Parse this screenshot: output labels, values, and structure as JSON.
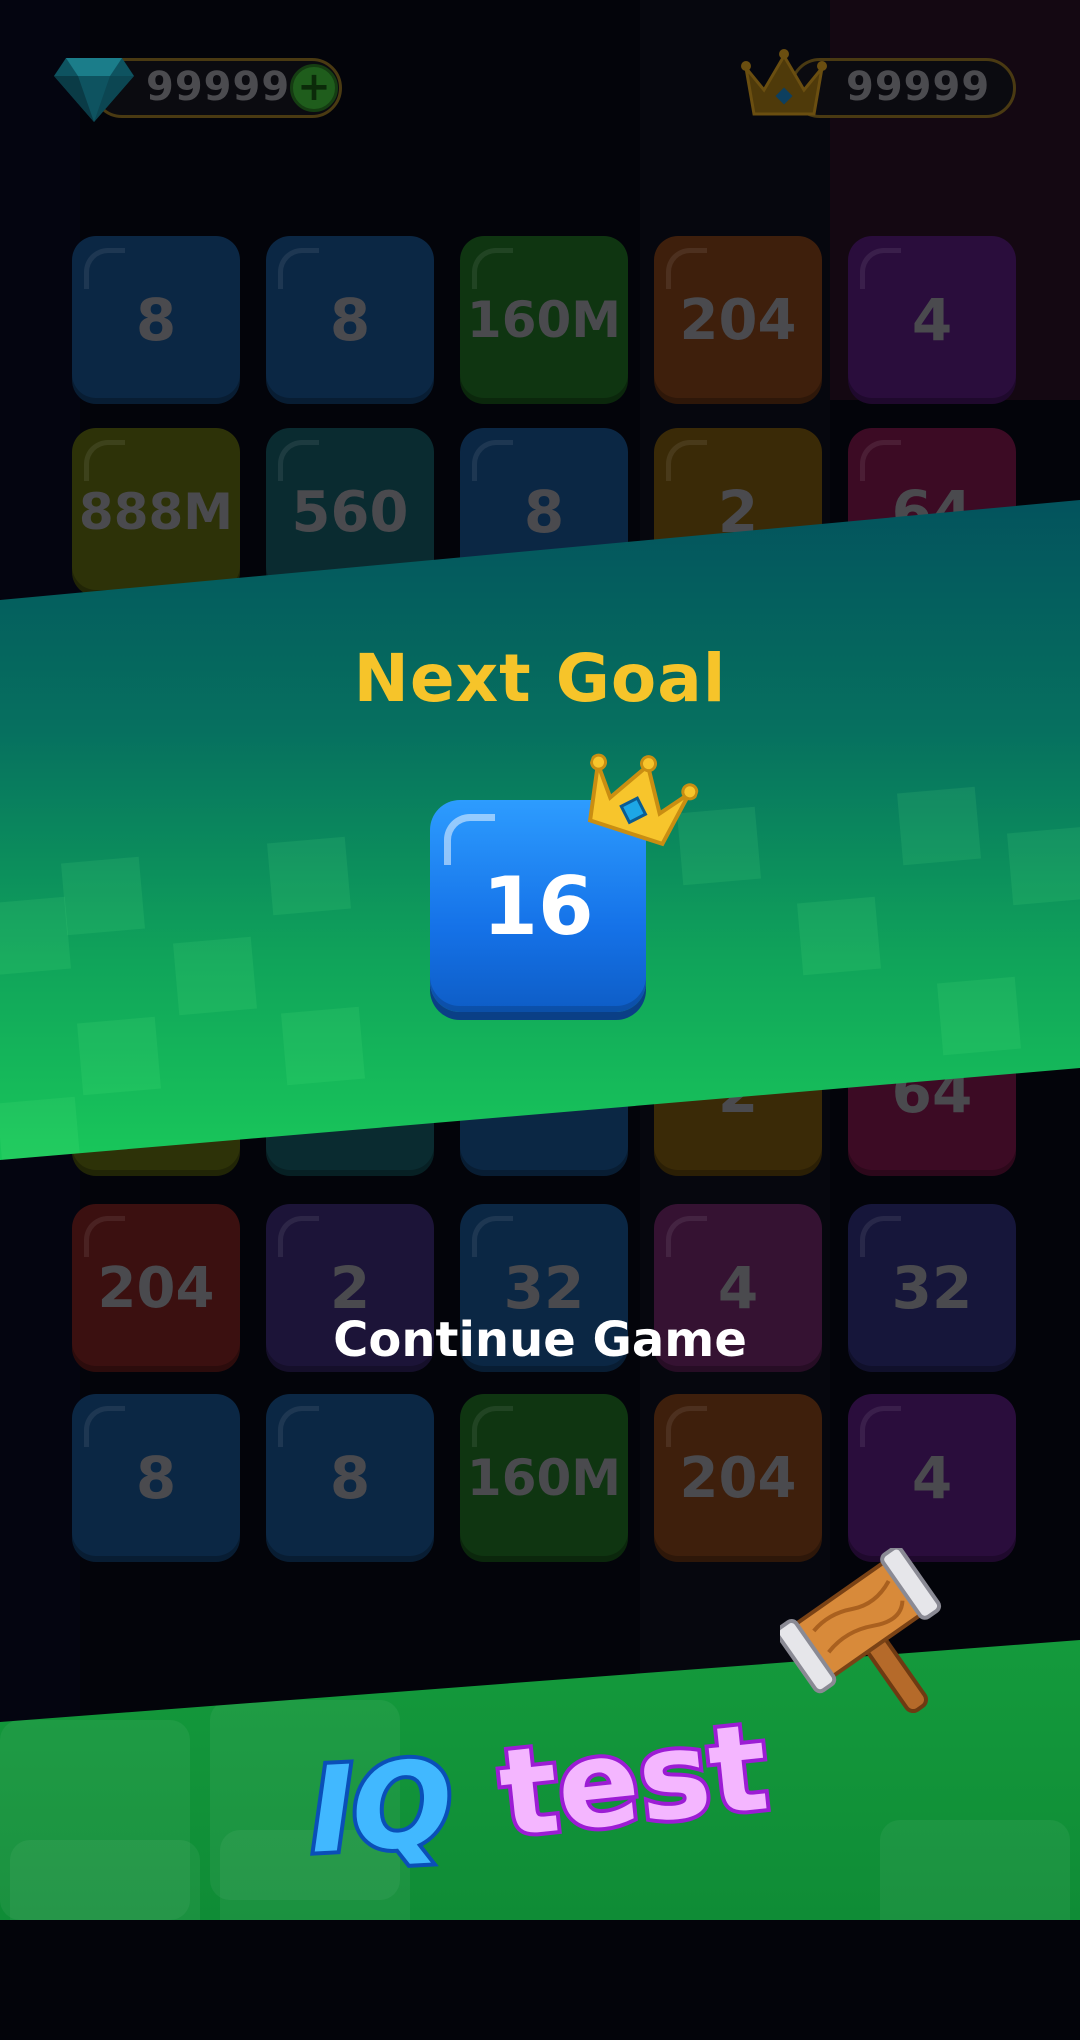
{
  "top_bar": {
    "gems": {
      "icon": "diamond-icon",
      "value": "99999",
      "add_icon": "plus-icon"
    },
    "crowns": {
      "icon": "crown-icon",
      "value": "99999"
    }
  },
  "board": {
    "rows": [
      [
        "8",
        "8",
        "160M",
        "204",
        "4"
      ],
      [
        "888M",
        "560",
        "8",
        "2",
        "64"
      ],
      [
        "",
        "",
        "",
        "2",
        "64"
      ],
      [
        "204",
        "2",
        "32",
        "4",
        "32"
      ],
      [
        "8",
        "8",
        "160M",
        "204",
        "4"
      ]
    ]
  },
  "overlay": {
    "title": "Next Goal",
    "goal_tile": {
      "value": "16",
      "icon": "crown-icon"
    },
    "continue_label": "Continue Game"
  },
  "logo": {
    "part1": "IQ",
    "part2": "test",
    "icon": "hammer-icon"
  },
  "colors": {
    "accent_gold": "#f6c42a",
    "goal_tile_blue": "#1572e8",
    "banner_top": "#03535d",
    "banner_bottom": "#19c75a"
  }
}
